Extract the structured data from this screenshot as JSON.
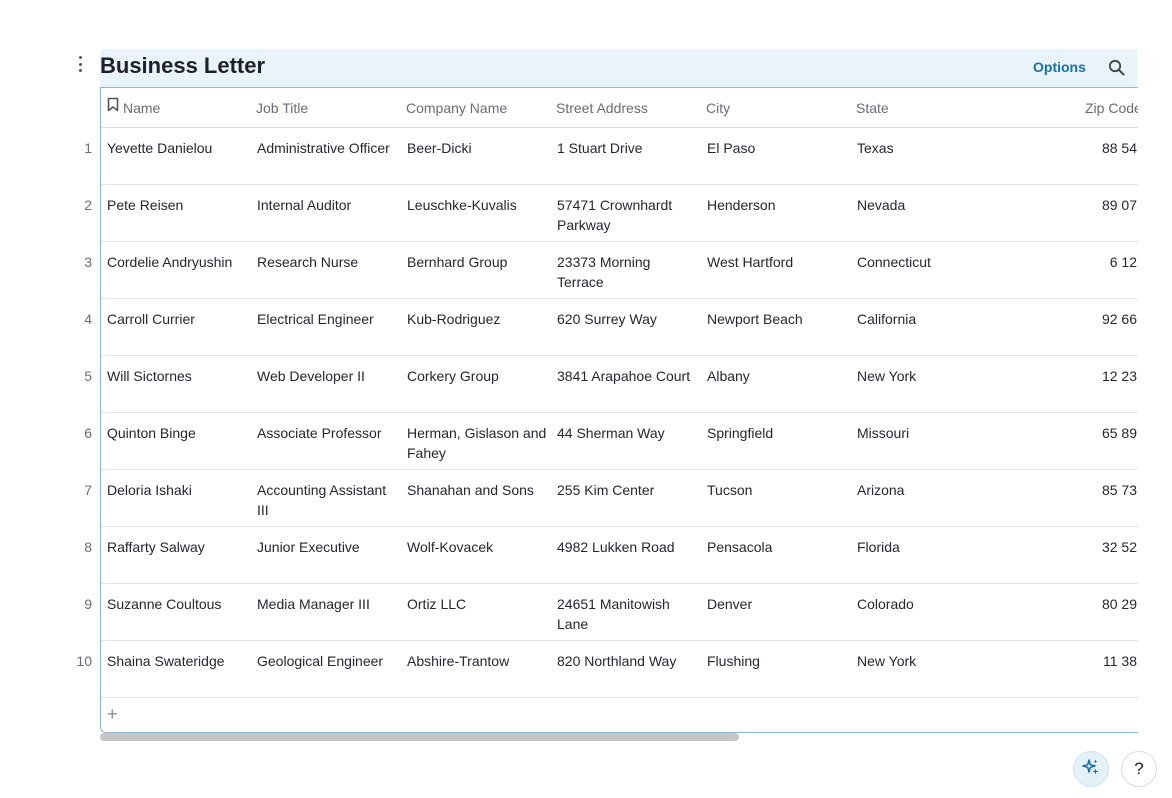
{
  "page": {
    "title": "Business Letter",
    "options_label": "Options"
  },
  "table": {
    "columns": [
      "Name",
      "Job Title",
      "Company Name",
      "Street Address",
      "City",
      "State",
      "Zip Code"
    ],
    "rows": [
      {
        "num": "1",
        "name": "Yevette Danielou",
        "job": "Administrative Officer",
        "company": "Beer-Dicki",
        "street": "1 Stuart Drive",
        "city": "El Paso",
        "state": "Texas",
        "zip": "88 54"
      },
      {
        "num": "2",
        "name": "Pete Reisen",
        "job": "Internal Auditor",
        "company": "Leuschke-Kuvalis",
        "street": "57471 Crownhardt Parkway",
        "city": "Henderson",
        "state": "Nevada",
        "zip": "89 07"
      },
      {
        "num": "3",
        "name": "Cordelie Andryushin",
        "job": "Research Nurse",
        "company": "Bernhard Group",
        "street": "23373 Morning Terrace",
        "city": "West Hartford",
        "state": "Connecticut",
        "zip": "6 12"
      },
      {
        "num": "4",
        "name": "Carroll Currier",
        "job": "Electrical Engineer",
        "company": "Kub-Rodriguez",
        "street": "620 Surrey Way",
        "city": "Newport Beach",
        "state": "California",
        "zip": "92 66"
      },
      {
        "num": "5",
        "name": "Will Sictornes",
        "job": "Web Developer II",
        "company": "Corkery Group",
        "street": "3841 Arapahoe Court",
        "city": "Albany",
        "state": "New York",
        "zip": "12 23"
      },
      {
        "num": "6",
        "name": "Quinton Binge",
        "job": "Associate Professor",
        "company": "Herman, Gislason and Fahey",
        "street": "44 Sherman Way",
        "city": "Springfield",
        "state": "Missouri",
        "zip": "65 89"
      },
      {
        "num": "7",
        "name": "Deloria Ishaki",
        "job": "Accounting Assistant III",
        "company": "Shanahan and Sons",
        "street": "255 Kim Center",
        "city": "Tucson",
        "state": "Arizona",
        "zip": "85 73"
      },
      {
        "num": "8",
        "name": "Raffarty Salway",
        "job": "Junior Executive",
        "company": "Wolf-Kovacek",
        "street": "4982 Lukken Road",
        "city": "Pensacola",
        "state": "Florida",
        "zip": "32 52"
      },
      {
        "num": "9",
        "name": "Suzanne Coultous",
        "job": "Media Manager III",
        "company": "Ortiz LLC",
        "street": "24651 Manitowish Lane",
        "city": "Denver",
        "state": "Colorado",
        "zip": "80 29"
      },
      {
        "num": "10",
        "name": "Shaina Swateridge",
        "job": "Geological Engineer",
        "company": "Abshire-Trantow",
        "street": "820 Northland Way",
        "city": "Flushing",
        "state": "New York",
        "zip": "11 38"
      }
    ],
    "add_row_label": "+"
  },
  "footer": {
    "help_label": "?"
  },
  "icons": {
    "menu": "kebab-icon",
    "search": "search-icon",
    "primary_column": "bookmark-icon",
    "ai": "sparkle-icon"
  },
  "colors": {
    "accent": "#1a6fa8",
    "title_bar": "#e8f4f9"
  }
}
